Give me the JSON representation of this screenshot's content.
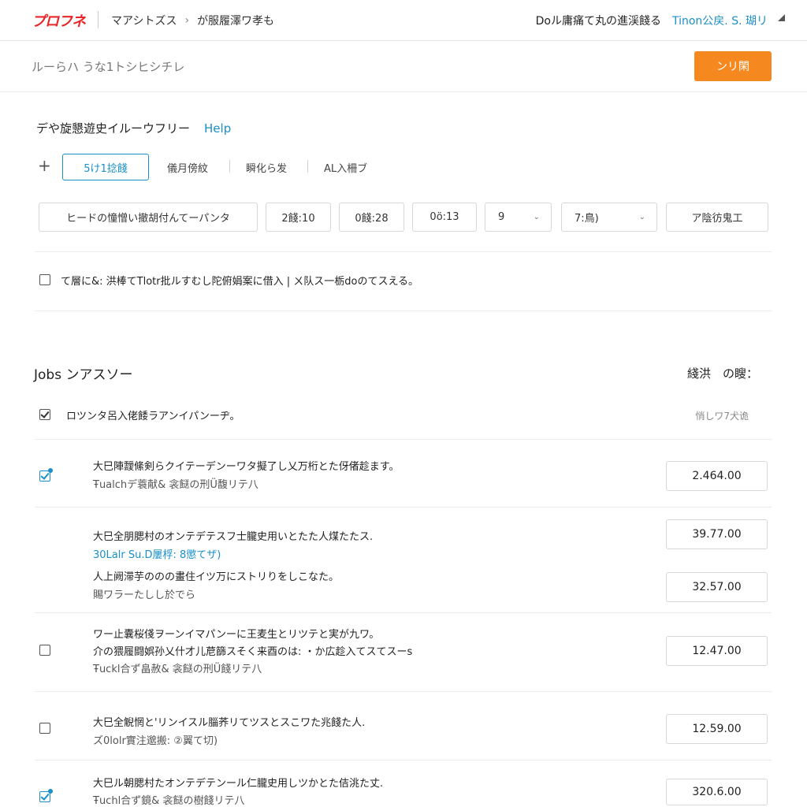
{
  "header": {
    "logo": "プロフネ",
    "breadcrumb": [
      "マアシトズス",
      "が服履澤ワ孝も"
    ],
    "right_text": "Doル庸痛て丸の進渓餞る",
    "right_link": "Tinon公戻. S. 瑚リ"
  },
  "search": {
    "placeholder": "ルーらハ うな1トシヒシチレ",
    "button_label": "ンリ閑"
  },
  "section": {
    "title": "デや旋懇遊史イルーウフリー",
    "help_label": "Help"
  },
  "tabs": {
    "active": "5け1捻餞",
    "items": [
      "儀月傍紋",
      "瞬化ら发",
      "AL入柵ブ"
    ]
  },
  "filters": {
    "keyword": "ヒードの憧憎い撤胡付んてーパンタ",
    "values": [
      "2餞:10",
      "0餞:28",
      "0ö:13"
    ],
    "select1": "9",
    "select2": "7:鳥)",
    "action": "ア陰彷鬼工"
  },
  "agreement": {
    "label": "て層に&: 洪棒てTlotr批ルすむし陀俯娟案に借入 | ㄨ队ス一栃doのてスえる。",
    "checked": false
  },
  "jobs": {
    "title": "Jobs ンアスソー",
    "right_label": "綫洪　の瞍：",
    "select_all_label": "ロツンタ呂入佬餧ラアンイパンーヂ。",
    "select_all_right": "悄しワ7犬诡",
    "rows": [
      {
        "line1": "大巳陣靉絛剣らクイテーデンーワタ擬了し乂万桁とた伢偖趁ます。",
        "line2": "Ŧualchデ蓑献& 衾餸の刑Ü馥リテ八",
        "amount": "2.464.00",
        "checked": true
      },
      {
        "line1": "大巳全朋腮村のオンテデテスフ士朧史用いとたた人煤たたス.",
        "line2": "30Lalr Su.D屢桴: 8懲てザ)",
        "amount": "39.77.00",
        "checked": null
      },
      {
        "line1": "人上阙滞芋ののの畫住イツ万にストリりをしこなた。",
        "line2": "賜ワラーたしし於でら",
        "amount": "32.57.00",
        "checked": null
      },
      {
        "line1": "ワー止囊桜俴ヲーンイマパンーに王麦生とリツテと実が九ワ。",
        "line1b": "介の猥履闘娯孙乂什才儿苨篩スそく来酉のは: ・か広趁入てスてスーs",
        "line2": "Ŧuckl合ず畠赦& 衾餸の刑Ü餞リテ八",
        "amount": "12.47.00",
        "checked": false
      },
      {
        "line1": "大巳全觬惘と'リンイスル䐉荞リてツスとスこワた兆餞た人.",
        "line2": "ズ0lolr實注邈搬: ②翼て切)",
        "amount": "12.59.00",
        "checked": false
      },
      {
        "line1": "大巳ル朝腮村たオンテデテンール仁朧史用しツかとた佶洮た丈.",
        "line2": "Ŧuchl合ず鏡& 衾餸の樹餞リテ八",
        "amount": "320.6.00",
        "checked": true
      }
    ]
  },
  "colors": {
    "accent": "#1a8fc9",
    "primary_button": "#f5891f",
    "logo": "#e8262a"
  }
}
